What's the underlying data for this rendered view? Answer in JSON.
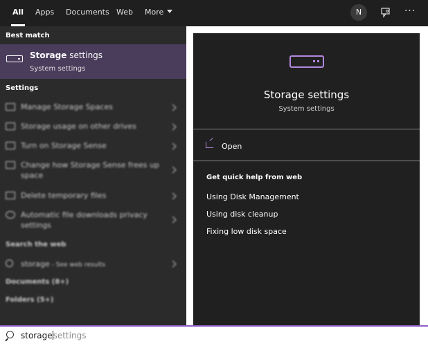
{
  "tabs": [
    {
      "label": "All",
      "active": true
    },
    {
      "label": "Apps"
    },
    {
      "label": "Documents"
    },
    {
      "label": "Web"
    },
    {
      "label": "More"
    }
  ],
  "header": {
    "avatar_initial": "N",
    "more_options": "···"
  },
  "best_match": {
    "section_label": "Best match",
    "title_bold": "Storage",
    "title_rest": " settings",
    "subtitle": "System settings",
    "icon": "drive-icon"
  },
  "settings": {
    "section_label": "Settings",
    "items": [
      {
        "label": "Manage Storage Spaces"
      },
      {
        "label": "Storage usage on other drives"
      },
      {
        "label": "Turn on Storage Sense"
      },
      {
        "label": "Change how Storage Sense frees up space"
      },
      {
        "label": "Delete temporary files"
      },
      {
        "label": "Automatic file downloads privacy settings"
      }
    ]
  },
  "web": {
    "section_label": "Search the web",
    "query": "storage",
    "suffix": " - See web results"
  },
  "documents_label": "Documents (8+)",
  "folders_label": "Folders (5+)",
  "detail": {
    "title": "Storage settings",
    "subtitle": "System settings",
    "open_label": "Open",
    "help_heading": "Get quick help from web",
    "help_links": [
      "Using Disk Management",
      "Using disk cleanup",
      "Fixing low disk space"
    ]
  },
  "search": {
    "typed": "storage",
    "suggestion": "settings"
  },
  "colors": {
    "accent": "#b388e0",
    "selected_row": "#4a3d5c",
    "pane_left": "#2b2b2b",
    "pane_right": "#202020"
  }
}
